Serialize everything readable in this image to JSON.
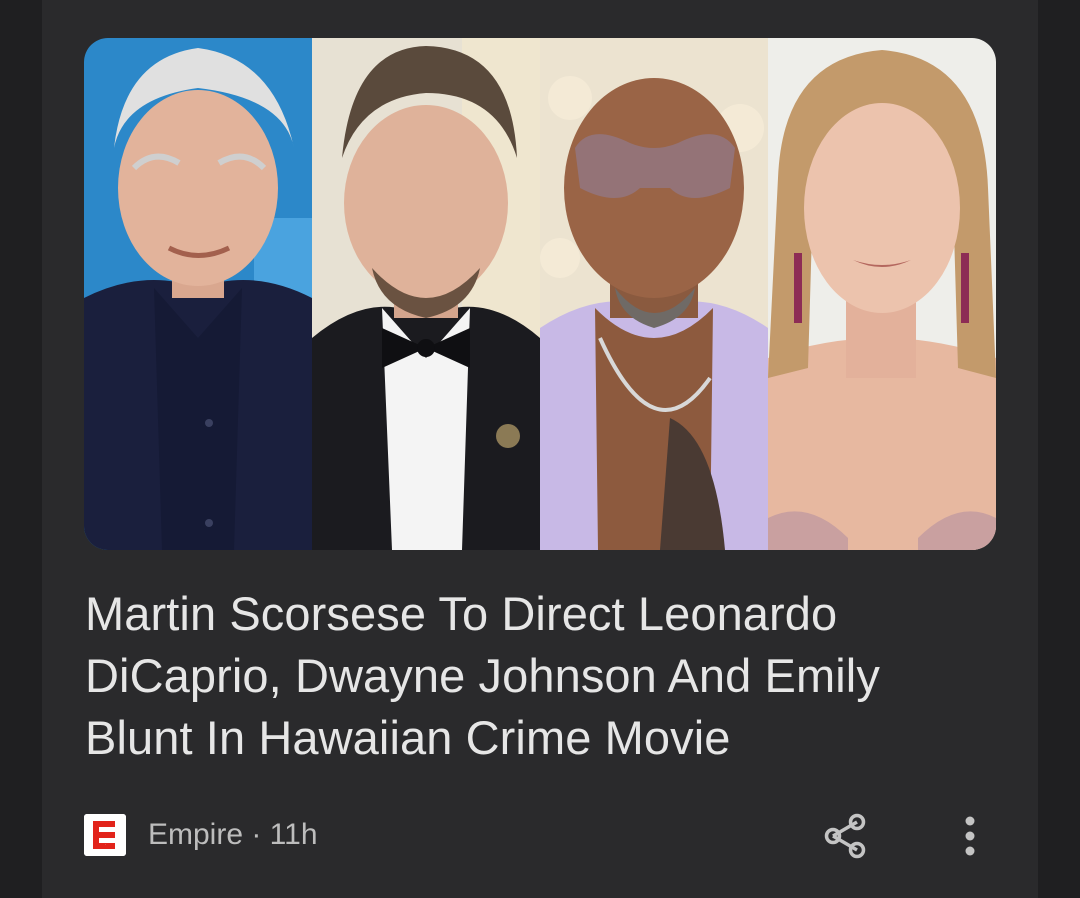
{
  "article": {
    "headline": "Martin Scorsese To Direct Leonardo DiCaprio, Dwayne Johnson And Emily Blunt In Hawaiian Crime Movie",
    "source": "Empire",
    "separator": "·",
    "age": "11h",
    "source_line": "Empire · 11h",
    "logo_letter": "E"
  },
  "image": {
    "panels": [
      "portrait-1",
      "portrait-2",
      "portrait-3",
      "portrait-4"
    ]
  },
  "actions": {
    "share_icon": "share-icon",
    "more_icon": "more-vert-icon"
  },
  "colors": {
    "background": "#1f1f21",
    "card": "#2a2a2c",
    "headline_text": "#e6e6e6",
    "meta_text": "#bdbdbd",
    "logo_red": "#e2231a",
    "icon": "#c4c4c4"
  }
}
